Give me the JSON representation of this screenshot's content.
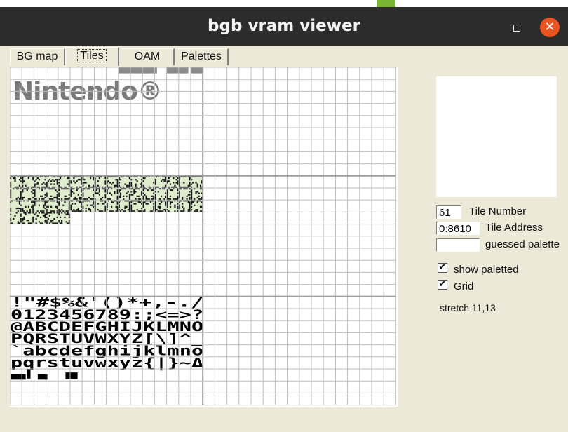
{
  "window": {
    "title": "bgb vram viewer"
  },
  "titlebar": {
    "maximize_icon": "maximize-icon",
    "close_icon": "close-icon",
    "close_glyph": "✕"
  },
  "tabs": [
    {
      "label": "BG map",
      "active": false
    },
    {
      "label": "Tiles",
      "active": true
    },
    {
      "label": "OAM",
      "active": false
    },
    {
      "label": "Palettes",
      "active": false
    }
  ],
  "tiles": {
    "font_rows": [
      " !\"#$%&'()*+,-./",
      "0123456789:;<=>?",
      "@ABCDEFGHIJKLMNO",
      "PQRSTUVWXYZ[\\]^_",
      "`abcdefghijklmno",
      "pqrstuvwxyz{|}~Δ"
    ],
    "logo_text": "Nintendo®",
    "highlight_color": "#dfeccd",
    "grid_color": "#bdbdbd",
    "bank_divider_color": "#9a9a9a"
  },
  "info": {
    "tile_number": {
      "value": "61",
      "label": "Tile Number"
    },
    "tile_address": {
      "value": "0:8610",
      "label": "Tile Address"
    },
    "guessed_palette": {
      "value": "",
      "label": "guessed palette"
    },
    "show_paletted": {
      "label": "show paletted",
      "checked": true,
      "mark": "✔"
    },
    "grid": {
      "label": "Grid",
      "checked": true,
      "mark": "✔"
    },
    "stretch": "stretch 11,13"
  }
}
